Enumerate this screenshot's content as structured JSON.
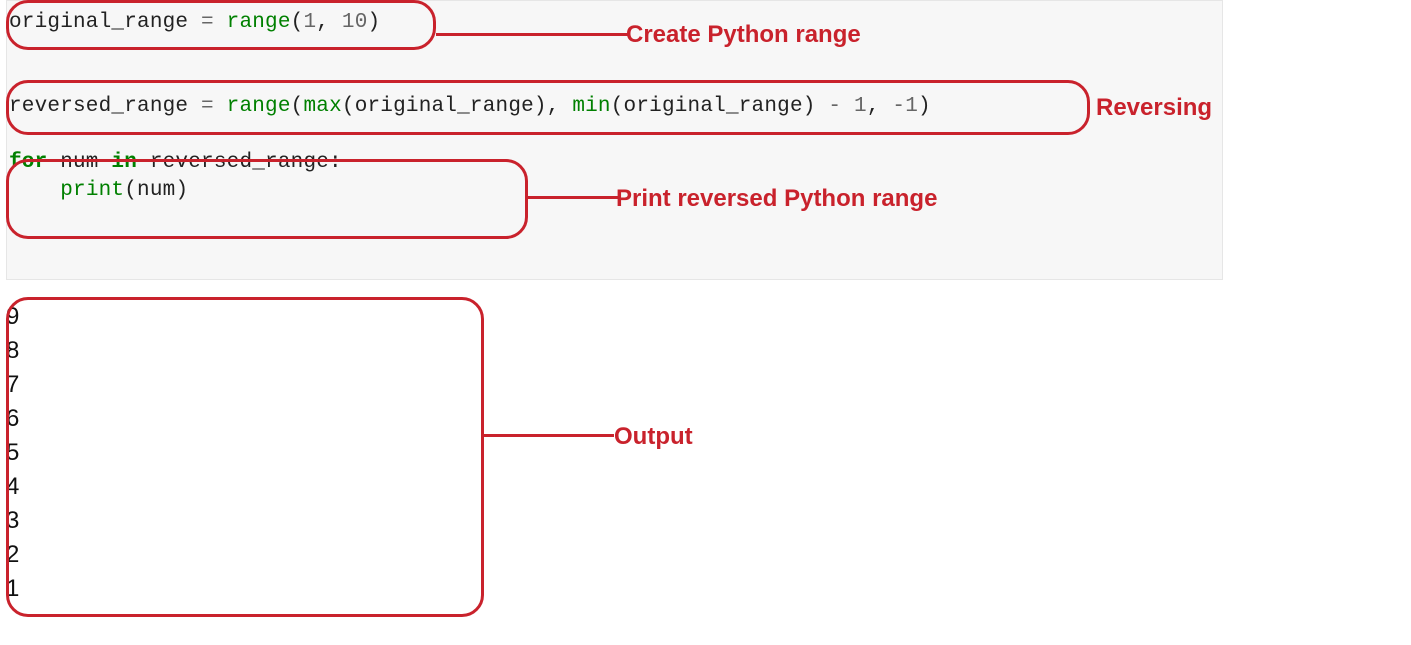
{
  "code": {
    "l1": {
      "a": "original_range ",
      "eq": "=",
      "b": " ",
      "fn": "range",
      "c": "(",
      "n1": "1",
      "d": ", ",
      "n2": "10",
      "e": ")"
    },
    "l2": {
      "a": "reversed_range ",
      "eq": "=",
      "b": " ",
      "fn1": "range",
      "c": "(",
      "fn2": "max",
      "d": "(original_range), ",
      "fn3": "min",
      "e": "(original_range) ",
      "op": "-",
      "f": " ",
      "n1": "1",
      "g": ", ",
      "n2": "-",
      "n3": "1",
      "h": ")"
    },
    "l3": {
      "kw1": "for",
      "a": " num ",
      "kw2": "in",
      "b": " reversed_range:"
    },
    "l4": {
      "a": "    ",
      "fn": "print",
      "b": "(num)"
    }
  },
  "output": [
    "9",
    "8",
    "7",
    "6",
    "5",
    "4",
    "3",
    "2",
    "1"
  ],
  "labels": {
    "create": "Create Python range",
    "reversing": "Reversing",
    "print": "Print reversed Python range",
    "output": "Output"
  }
}
